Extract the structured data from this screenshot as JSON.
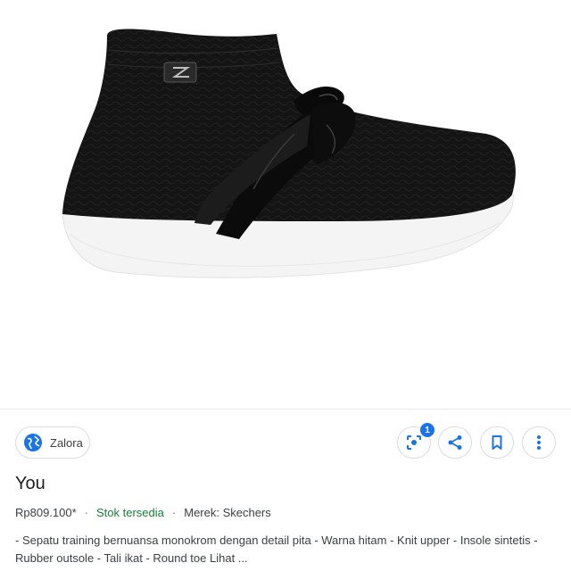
{
  "result": {
    "source": {
      "name": "Zalora",
      "icon": "globe-icon"
    },
    "lens_badge_count": "1",
    "actions": {
      "lens_icon": "lens-icon",
      "share_icon": "share-icon",
      "save_icon": "bookmark-icon",
      "more_icon": "more-vert-icon"
    },
    "title": "You",
    "price": "Rp809.100*",
    "separator": "·",
    "stock": "Stok tersedia",
    "brand": "Merek: Skechers",
    "description": "- Sepatu training bernuansa monokrom dengan detail pita - Warna hitam - Knit upper - Insole sintetis - Rubber outsole - Tali ikat - Round toe Lihat ..."
  },
  "colors": {
    "accent": "#1a73e8",
    "stock_green": "#188038",
    "border": "#dadce0",
    "text": "#202124"
  }
}
